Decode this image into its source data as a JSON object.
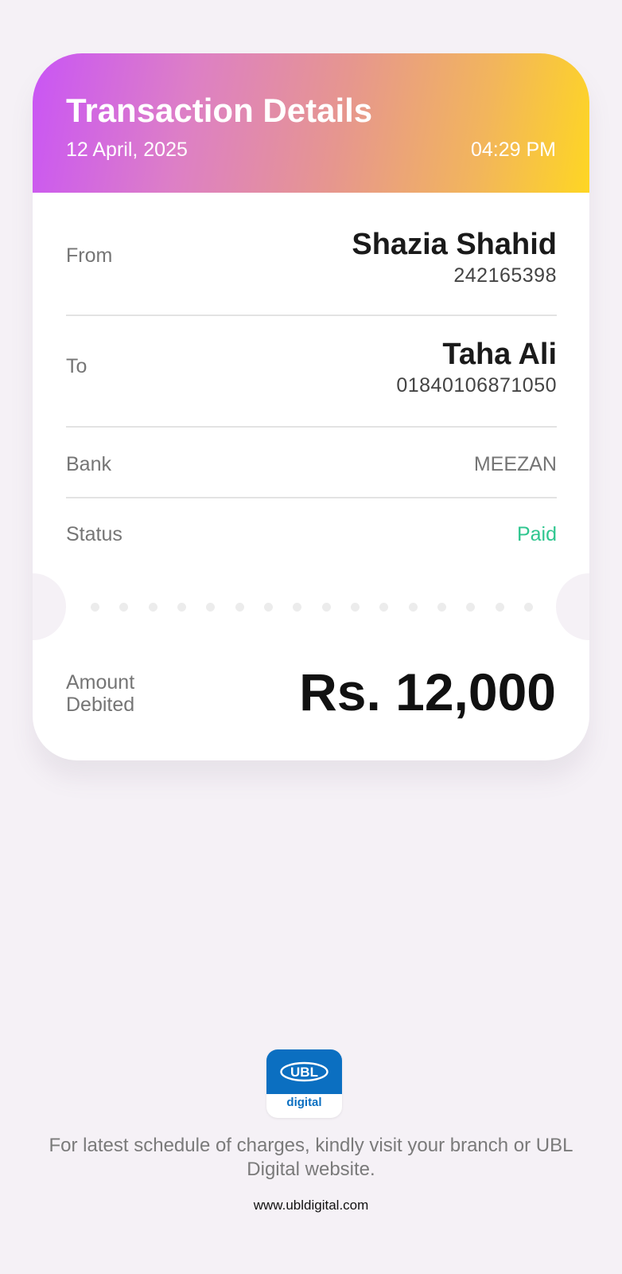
{
  "header": {
    "title": "Transaction Details",
    "date": "12 April, 2025",
    "time": "04:29 PM",
    "gradient_colors": [
      "#c955f5",
      "#dd7fc6",
      "#e6968f",
      "#f2b55c",
      "#fed623"
    ]
  },
  "details": {
    "from": {
      "label": "From",
      "name": "Shazia Shahid",
      "account": "242165398"
    },
    "to": {
      "label": "To",
      "name": "Taha Ali",
      "account": "01840106871050"
    },
    "bank": {
      "label": "Bank",
      "value": "MEEZAN"
    },
    "status": {
      "label": "Status",
      "value": "Paid",
      "color": "#2fc68f"
    }
  },
  "amount": {
    "label": "Amount Debited",
    "value": "Rs. 12,000"
  },
  "footer": {
    "logo_text": "UBL",
    "logo_subtext": "digital",
    "logo_color": "#0b6fc1",
    "note": "For latest schedule of charges, kindly visit your branch or UBL Digital website.",
    "url": "www.ubldigital.com"
  }
}
